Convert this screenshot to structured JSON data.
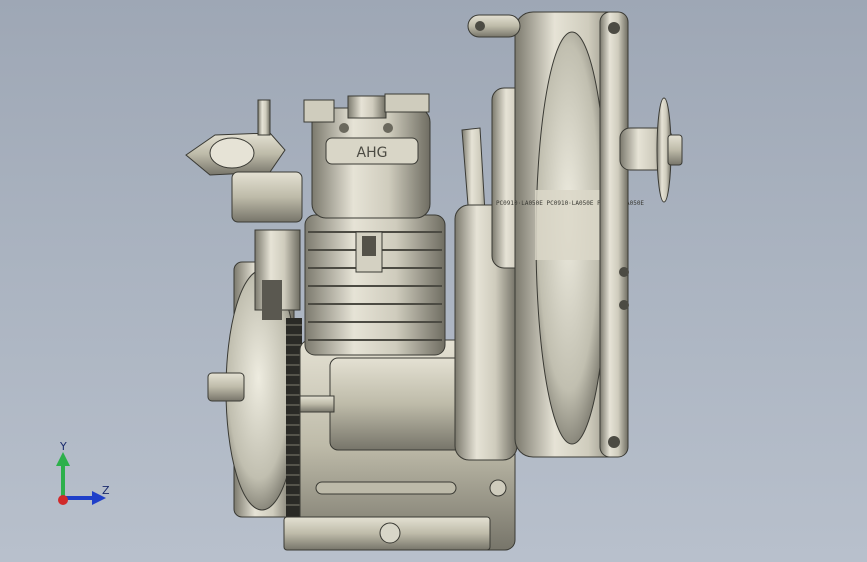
{
  "viewport": {
    "background_top": "#9ea7b5",
    "background_bottom": "#b8c0cc"
  },
  "model": {
    "engraving_head": "AHG",
    "flywheel_text": "PC0910·LA050E PC0910·LA050E PC0910·LA050E"
  },
  "triad": {
    "y_label": "Y",
    "z_label": "Z",
    "y_color": "#2db04b",
    "z_color": "#1f3fc9",
    "x_color": "#d12a2a"
  }
}
